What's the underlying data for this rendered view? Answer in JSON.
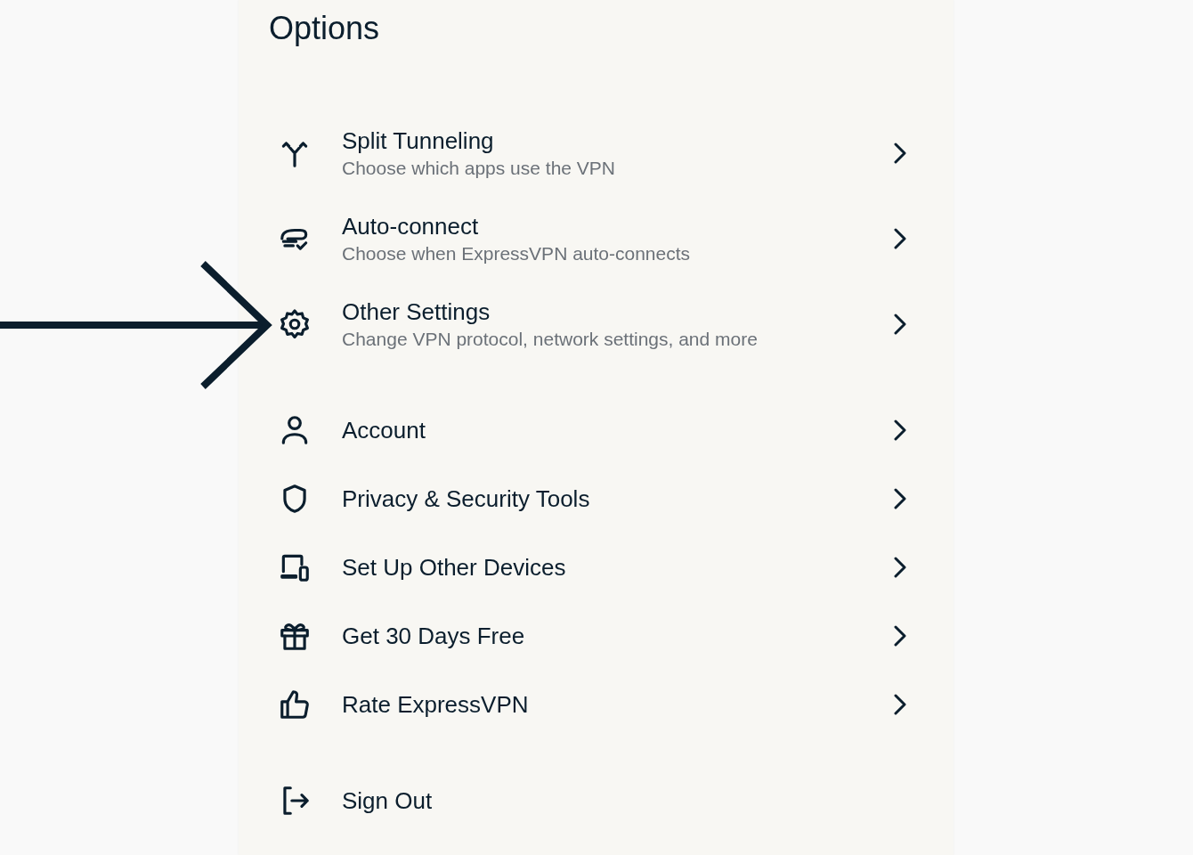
{
  "title": "Options",
  "groups": [
    {
      "items": [
        {
          "title": "Split Tunneling",
          "subtitle": "Choose which apps use the VPN"
        },
        {
          "title": "Auto-connect",
          "subtitle": "Choose when ExpressVPN auto-connects"
        },
        {
          "title": "Other Settings",
          "subtitle": "Change VPN protocol, network settings, and more"
        }
      ]
    },
    {
      "items": [
        {
          "title": "Account"
        },
        {
          "title": "Privacy & Security Tools"
        },
        {
          "title": "Set Up Other Devices"
        },
        {
          "title": "Get 30 Days Free"
        },
        {
          "title": "Rate ExpressVPN"
        }
      ]
    }
  ],
  "sign_out": {
    "label": "Sign Out"
  }
}
